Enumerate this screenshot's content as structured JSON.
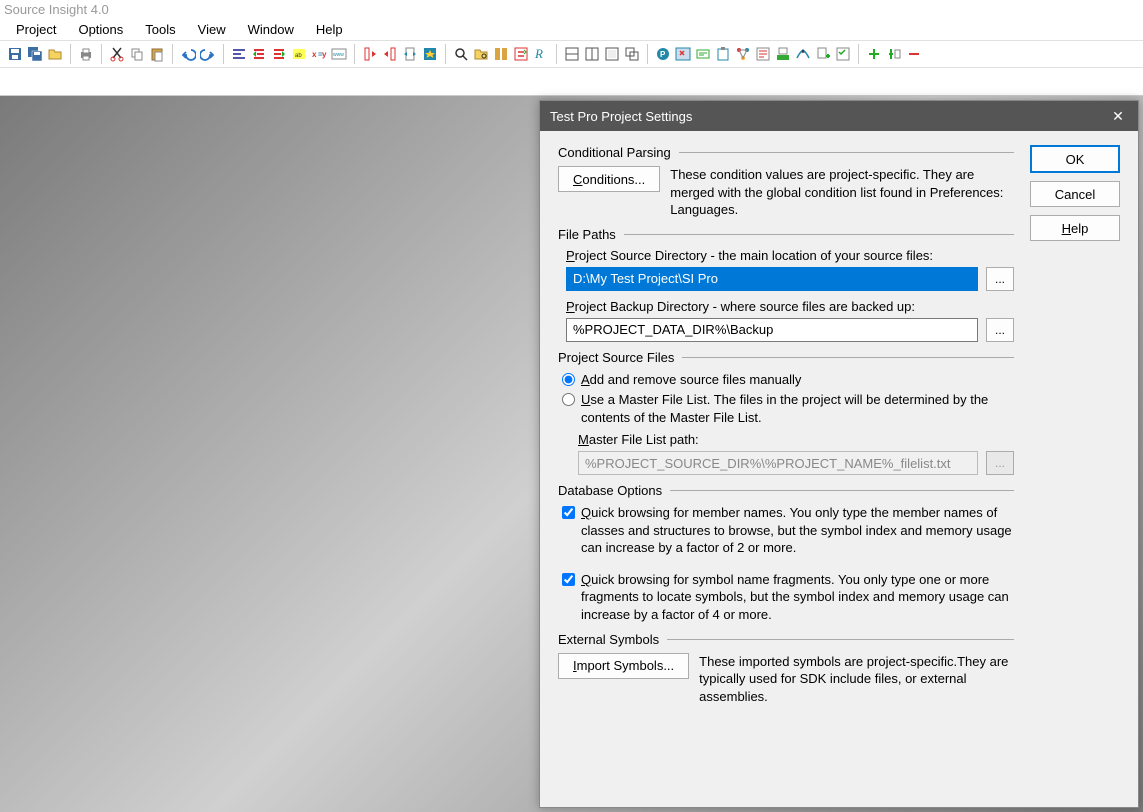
{
  "app_title": "Source Insight 4.0",
  "menus": [
    "Project",
    "Options",
    "Tools",
    "View",
    "Window",
    "Help"
  ],
  "dialog": {
    "title": "Test Pro Project Settings",
    "buttons": {
      "ok": "OK",
      "cancel": "Cancel",
      "help": "Help"
    },
    "conditional": {
      "heading": "Conditional Parsing",
      "conditions_btn": "Conditions...",
      "desc": "These condition values are project-specific.  They are merged with the global condition list found in Preferences: Languages."
    },
    "paths": {
      "heading": "File Paths",
      "source_label": "Project Source Directory - the main location of your source files:",
      "source_value": "D:\\My Test Project\\SI Pro",
      "backup_label": "Project Backup Directory - where source files are backed up:",
      "backup_value": "%PROJECT_DATA_DIR%\\Backup"
    },
    "source_files": {
      "heading": "Project Source Files",
      "opt_manual": "Add and remove source files manually",
      "opt_master": "Use a Master File List. The files in the project will be determined by the contents of the Master File List.",
      "master_label": "Master File List path:",
      "master_value": "%PROJECT_SOURCE_DIR%\\%PROJECT_NAME%_filelist.txt"
    },
    "database": {
      "heading": "Database Options",
      "opt1": "Quick browsing for member names.  You only type the member names of classes and structures to browse, but the symbol index and memory usage can increase by a factor of 2 or more.",
      "opt2": "Quick browsing for symbol name fragments.  You only type one or more fragments to locate symbols, but the symbol index and memory usage can increase by a factor of 4 or more."
    },
    "external": {
      "heading": "External Symbols",
      "import_btn": "Import Symbols...",
      "desc": "These imported symbols are project-specific.They are typically used for SDK include files, or external assemblies."
    }
  }
}
